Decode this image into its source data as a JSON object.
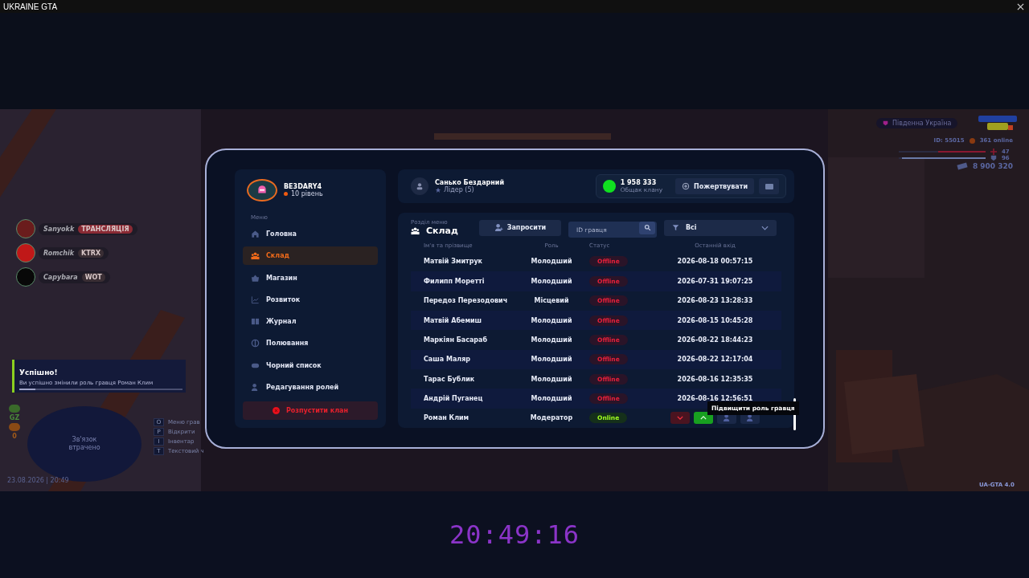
{
  "window": {
    "title": "UKRAINE GTA"
  },
  "hud": {
    "streamers": [
      {
        "name": "Sanyokk",
        "tag": "ТРАНСЛЯЦІЯ",
        "kind": "live"
      },
      {
        "name": "Romchik",
        "tag": "KTRX",
        "kind": "game"
      },
      {
        "name": "Capybara",
        "tag": "WOT",
        "kind": "game"
      }
    ],
    "notification": {
      "title": "Успішно!",
      "message": "Ви успішно змінили роль гравця Роман Клим",
      "level": 0.1
    },
    "indicators": [
      "GZ",
      "0"
    ],
    "minimap": {
      "message": "Зв'язок втрачено"
    },
    "hotkeys": [
      {
        "key": "O",
        "label": "Меню грав"
      },
      {
        "key": "P",
        "label": "Відкрити"
      },
      {
        "key": "I",
        "label": "Інвентар"
      },
      {
        "key": "T",
        "label": "Текстовий ч"
      }
    ],
    "datetime": "23.08.2026 | 20:49",
    "region": "Південна Україна",
    "server_id": "ID: 55015",
    "online": "361 online",
    "health": {
      "value": "47",
      "level": 0.55
    },
    "armor": {
      "value": "96",
      "level": 0.96
    },
    "money": "8 900 320",
    "version": "UA-GTA 4.0"
  },
  "tablet": {
    "profile": {
      "name": "BE3DARY4",
      "level": "10 рівень"
    },
    "menu_heading": "Меню",
    "menu": [
      {
        "label": "Головна",
        "selected": false
      },
      {
        "label": "Склад",
        "selected": true
      },
      {
        "label": "Магазин",
        "selected": false
      },
      {
        "label": "Розвиток",
        "selected": false
      },
      {
        "label": "Журнал",
        "selected": false
      },
      {
        "label": "Полювання",
        "selected": false
      },
      {
        "label": "Чорний список",
        "selected": false
      },
      {
        "label": "Редагування ролей",
        "selected": false
      }
    ],
    "disband": "Розпустити клан",
    "user": {
      "name": "Санько Бездарний",
      "role": "Лідер (5)"
    },
    "treasury": {
      "amount": "1 958 333",
      "label": "Общак клану",
      "donate": "Пожертвувати"
    },
    "section": {
      "label": "Розділ меню",
      "title": "Склад"
    },
    "invite": "Запросити",
    "search": {
      "placeholder": "ID гравця"
    },
    "filter": "Всі",
    "table": {
      "columns": [
        "Ім'я та прізвище",
        "Роль",
        "Статус",
        "Останній вхід"
      ],
      "rows": [
        {
          "name": "Матвій Змитрук",
          "role": "Молодший",
          "status": "Offline",
          "online": false,
          "last": "2026-08-18 00:57:15"
        },
        {
          "name": "Филипп Моретті",
          "role": "Молодший",
          "status": "Offline",
          "online": false,
          "last": "2026-07-31 19:07:25"
        },
        {
          "name": "Передоз Перезодович",
          "role": "Місцевий",
          "status": "Offline",
          "online": false,
          "last": "2026-08-23 13:28:33"
        },
        {
          "name": "Матвій Абемиш",
          "role": "Молодший",
          "status": "Offline",
          "online": false,
          "last": "2026-08-15 10:45:28"
        },
        {
          "name": "Маркіян Басараб",
          "role": "Молодший",
          "status": "Offline",
          "online": false,
          "last": "2026-08-22 18:44:23"
        },
        {
          "name": "Саша Маляр",
          "role": "Молодший",
          "status": "Offline",
          "online": false,
          "last": "2026-08-22 12:17:04"
        },
        {
          "name": "Тарас Бублик",
          "role": "Молодший",
          "status": "Offline",
          "online": false,
          "last": "2026-08-16 12:35:35"
        },
        {
          "name": "Андрій Пуганец",
          "role": "Молодший",
          "status": "Offline",
          "online": false,
          "last": "2026-08-16 12:56:51"
        },
        {
          "name": "Роман Клим",
          "role": "Модератор",
          "status": "Online",
          "online": true,
          "actions": true
        }
      ]
    },
    "tooltip": "Підвищити роль гравця"
  },
  "clock": "20:49:16"
}
